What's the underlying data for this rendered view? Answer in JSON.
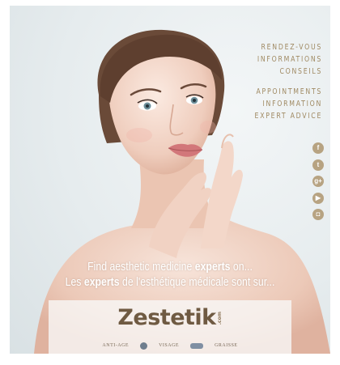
{
  "right_text": {
    "fr": [
      "RENDEZ-VOUS",
      "INFORMATIONS",
      "CONSEILS"
    ],
    "en": [
      "APPOINTMENTS",
      "INFORMATION",
      "EXPERT ADVICE"
    ]
  },
  "social": [
    {
      "icon": "facebook-icon",
      "glyph": "f"
    },
    {
      "icon": "twitter-icon",
      "glyph": "t"
    },
    {
      "icon": "google-plus-icon",
      "glyph": "g+"
    },
    {
      "icon": "youtube-icon",
      "glyph": "▶"
    },
    {
      "icon": "instagram-icon",
      "glyph": "◘"
    }
  ],
  "tagline_en": {
    "a": "Find aesthetic medicine ",
    "b": "experts",
    "c": " on..."
  },
  "tagline_fr": {
    "a": "Les ",
    "b": "experts",
    "c": " de l'esthétique médicale sont sur..."
  },
  "logo": {
    "main": "Zestetik",
    "suffix": ".com"
  },
  "strip": {
    "left": "ANTI-AGE",
    "mid": "VISAGE",
    "right": "GRAISSE"
  },
  "colors": {
    "gold": "#a08a63",
    "logo": "#6f5a42",
    "background": "#e6ecee"
  }
}
